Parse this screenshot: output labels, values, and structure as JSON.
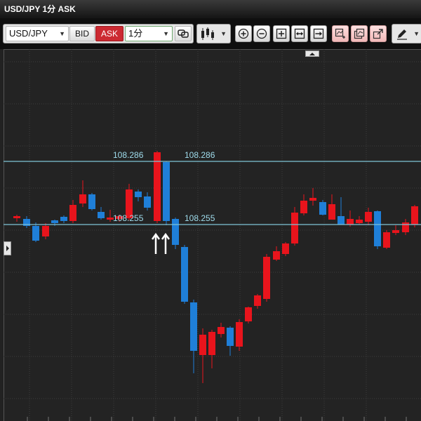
{
  "window": {
    "title": "USD/JPY 1分 ASK"
  },
  "toolbar": {
    "pair_value": "USD/JPY",
    "bid_label": "BID",
    "ask_label": "ASK",
    "interval_value": "1分",
    "colors": {
      "ask_active": "#cc2a32"
    }
  },
  "icons": [
    "link-icon",
    "candle-type-icon",
    "zoom-in-icon",
    "zoom-out-icon",
    "fit-icon",
    "expand-icon",
    "scroll-right-icon",
    "add-chart-icon",
    "duplicate-chart-icon",
    "detach-chart-icon",
    "draw-pen-icon"
  ],
  "chart": {
    "colors": {
      "up": "#e8141c",
      "down": "#1f7fd8",
      "lines": "#7fc4d6",
      "labels": "#9fdcec",
      "arrows": "#ffffff"
    },
    "lines": [
      {
        "left_label": "108.286",
        "right_label": "108.286"
      },
      {
        "left_label": "108.255",
        "right_label": "108.255"
      }
    ]
  }
}
